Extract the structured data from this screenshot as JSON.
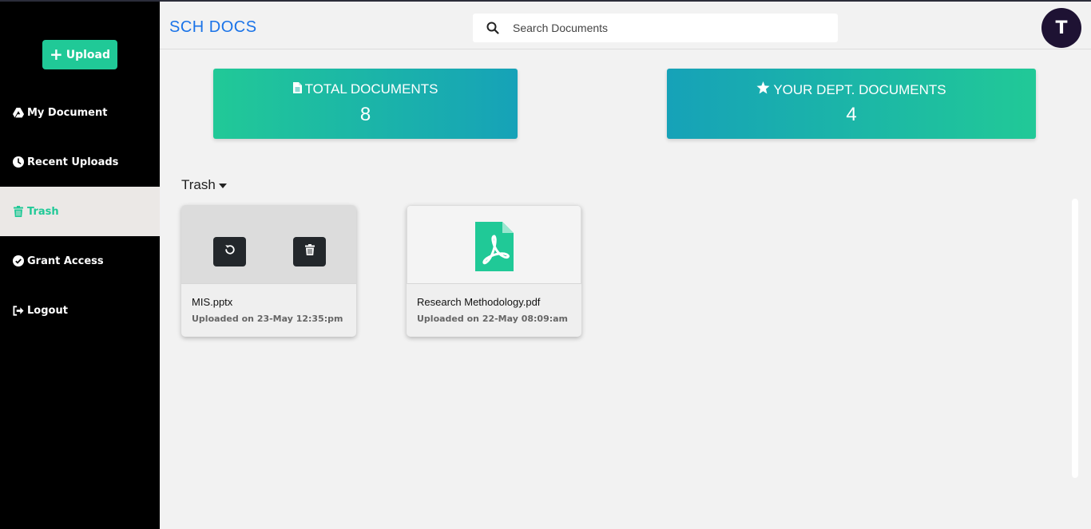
{
  "app": {
    "brand": "SCH DOCS"
  },
  "sidebar": {
    "upload_label": "Upload",
    "items": [
      {
        "label": "My Document",
        "icon": "drive-icon",
        "active": false
      },
      {
        "label": "Recent Uploads",
        "icon": "clock-icon",
        "active": false
      },
      {
        "label": "Trash",
        "icon": "trash-icon",
        "active": true
      },
      {
        "label": "Grant Access",
        "icon": "check-circle-icon",
        "active": false
      },
      {
        "label": "Logout",
        "icon": "sign-out-icon",
        "active": false
      }
    ]
  },
  "header": {
    "search_placeholder": "Search Documents",
    "avatar_initial": "T"
  },
  "stats": {
    "total": {
      "label": "TOTAL DOCUMENTS",
      "value": "8",
      "icon": "file-icon"
    },
    "dept": {
      "label": "YOUR DEPT. DOCUMENTS",
      "value": "4",
      "icon": "star-icon"
    }
  },
  "section": {
    "title": "Trash"
  },
  "files": [
    {
      "name": "MIS.pptx",
      "meta": "Uploaded on 23-May 12:35:pm",
      "icon": "pptx",
      "actions": [
        "restore-icon",
        "delete-icon"
      ]
    },
    {
      "name": "Research Methodology.pdf",
      "meta": "Uploaded on 22-May 08:09:am",
      "icon": "pdf-icon"
    }
  ],
  "colors": {
    "accent": "#20c997",
    "brand": "#1a73e8",
    "sidebar_bg": "#000000",
    "active_bg": "#ebe8e6",
    "avatar_bg": "#1e1233"
  }
}
